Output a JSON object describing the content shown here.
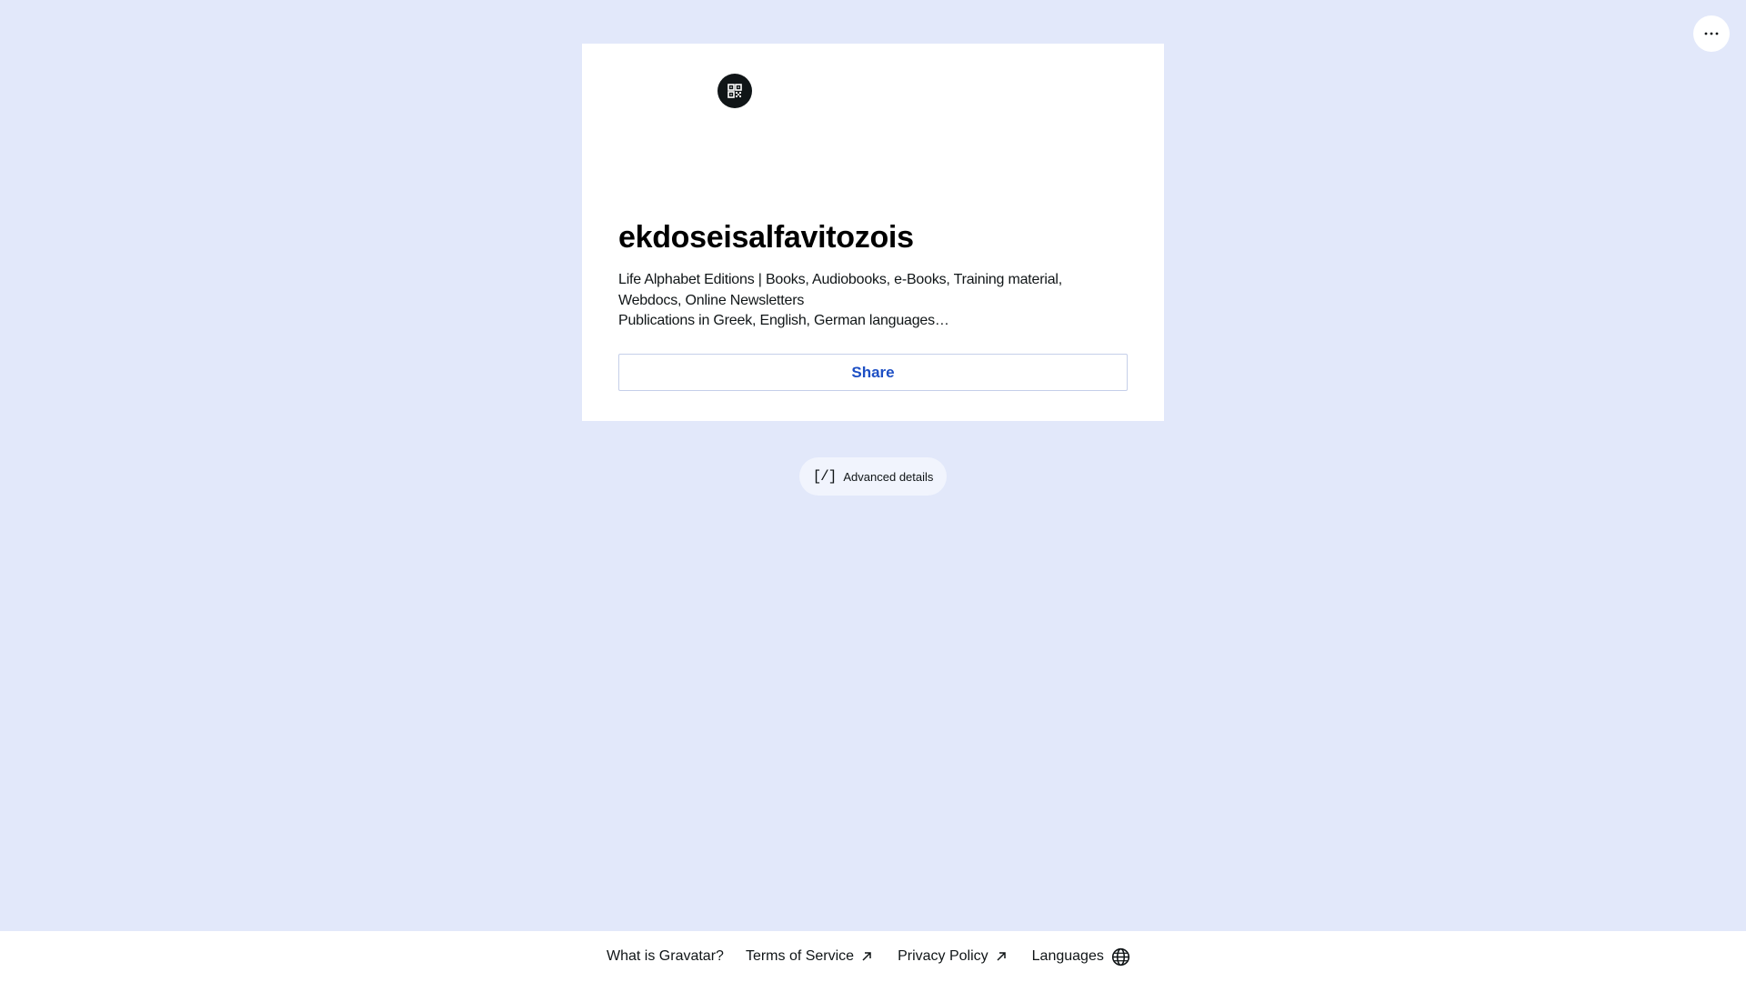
{
  "header": {
    "more_icon": "ellipsis-icon"
  },
  "profile": {
    "qr_icon": "qr-code-icon",
    "name": "ekdoseisalfavitozois",
    "bio_lines": [
      "Life Alphabet Editions | Books, Audiobooks, e-Books, Training material, Webdocs, Online Newsletters",
      "Publications in Greek, English, German languages…"
    ],
    "share_label": "Share"
  },
  "advanced": {
    "icon": "[/]",
    "label": "Advanced details"
  },
  "footer": {
    "links": [
      {
        "label": "What is Gravatar?"
      },
      {
        "label": "Terms of Service",
        "icon": "external-arrow-icon"
      },
      {
        "label": "Privacy Policy",
        "icon": "external-arrow-icon"
      },
      {
        "label": "Languages",
        "icon": "globe-icon"
      }
    ]
  },
  "colors": {
    "page_background": "#e2e8fa",
    "card_background": "#ffffff",
    "accent": "#1d4fc4",
    "text": "#101517"
  }
}
